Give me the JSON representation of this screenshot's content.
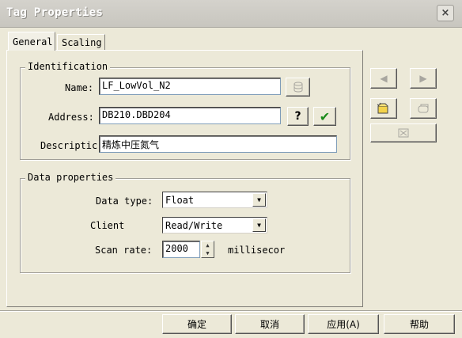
{
  "window": {
    "title": "Tag Properties",
    "close_label": "×"
  },
  "tabs": [
    {
      "label": "General",
      "active": true
    },
    {
      "label": "Scaling",
      "active": false
    }
  ],
  "identification": {
    "legend": "Identification",
    "name_label": "Name:",
    "name_value": "LF_LowVol_N2",
    "address_label": "Address:",
    "address_value": "DB210.DBD204",
    "description_label": "Descriptic",
    "description_value": "精炼中压氮气",
    "help_label": "?",
    "check_label": "✔"
  },
  "data_properties": {
    "legend": "Data properties",
    "data_type_label": "Data type:",
    "data_type_value": "Float",
    "client_label": "Client",
    "client_value": "Read/Write",
    "scan_rate_label": "Scan rate:",
    "scan_rate_value": "2000",
    "scan_rate_unit": "millisecor"
  },
  "nav": {
    "prev_label": "◀",
    "next_label": "▶"
  },
  "footer": {
    "ok_label": "确定",
    "cancel_label": "取消",
    "apply_label": "应用(A)",
    "help_label": "帮助"
  },
  "colors": {
    "dialog_bg": "#ece9d8",
    "check_green": "#1a8a1a",
    "titlebar": "#c8c6bf"
  }
}
